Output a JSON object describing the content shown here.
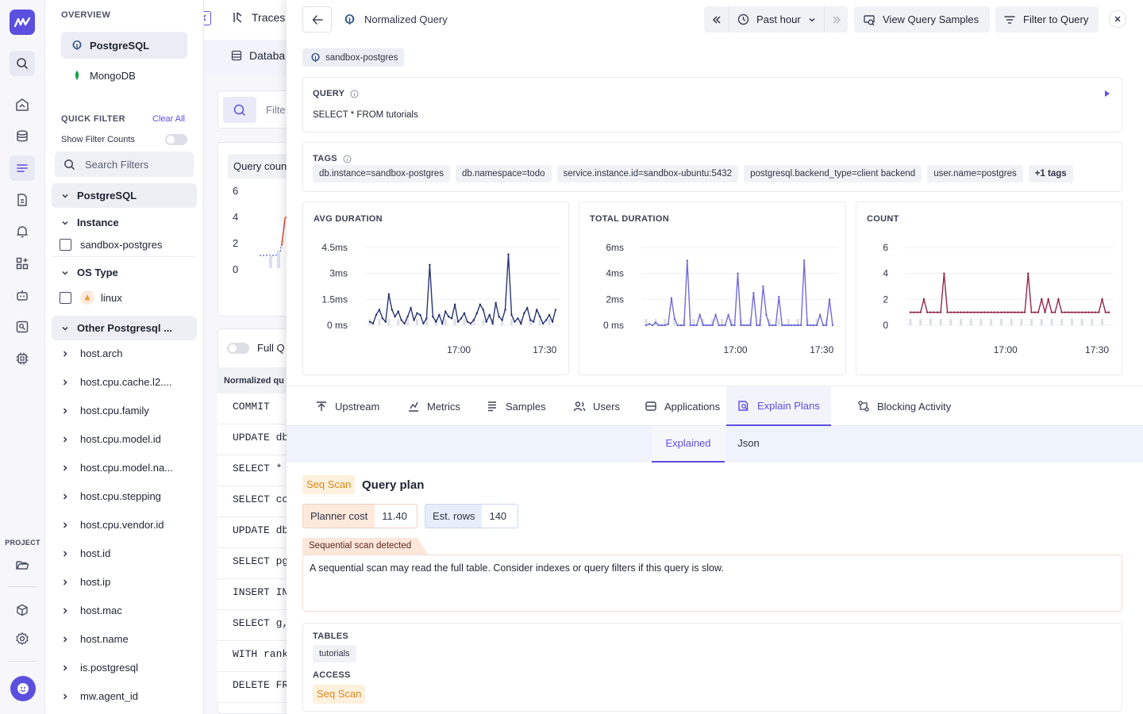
{
  "sidebar": {
    "project_label": "PROJECT",
    "icons": [
      "logo-icon",
      "search-icon",
      "dashboard-icon",
      "database-icon",
      "logs-icon",
      "document-icon",
      "alert-icon",
      "apps-icon",
      "robot-icon",
      "user-search-icon",
      "chip-icon",
      "folder-icon",
      "package-icon",
      "settings-icon",
      "avatar-icon"
    ]
  },
  "filter_panel": {
    "overview_title": "OVERVIEW",
    "databases": [
      {
        "label": "PostgreSQL",
        "selected": true
      },
      {
        "label": "MongoDB",
        "selected": false
      }
    ],
    "quick_filter_title": "QUICK FILTER",
    "clear_all": "Clear All",
    "show_filter_counts": "Show Filter Counts",
    "search_placeholder": "Search Filters",
    "groups": {
      "postgresql": "PostgreSQL",
      "instance": "Instance",
      "instance_value": "sandbox-postgres",
      "os_type": "OS Type",
      "os_value": "linux",
      "other": "Other Postgresql ..."
    },
    "attributes": [
      "host.arch",
      "host.cpu.cache.l2....",
      "host.cpu.family",
      "host.cpu.model.id",
      "host.cpu.model.na...",
      "host.cpu.stepping",
      "host.cpu.vendor.id",
      "host.id",
      "host.ip",
      "host.mac",
      "host.name",
      "is.postgresql",
      "mw.agent_id"
    ]
  },
  "background": {
    "traces_label": "Traces",
    "databases_tab": "Databa",
    "filter_placeholder": "Filte",
    "query_count_title": "Query coun",
    "query_count_ticks": [
      "6",
      "4",
      "2",
      "0"
    ],
    "full_query_label": "Full Q",
    "normalized_header": "Normalized qu",
    "rows": [
      "COMMIT",
      "UPDATE db",
      "SELECT *",
      "SELECT co",
      "UPDATE db",
      "SELECT pg",
      "INSERT IN",
      "SELECT g,",
      "WITH rank",
      "DELETE FR"
    ]
  },
  "drawer": {
    "title": "Normalized Query",
    "time_range": "Past hour",
    "view_samples": "View Query Samples",
    "filter_to_query": "Filter to Query",
    "instance_chip": "sandbox-postgres",
    "query_label": "QUERY",
    "query_text": "SELECT * FROM tutorials",
    "tags_label": "TAGS",
    "tags": [
      "db.instance=sandbox-postgres",
      "db.namespace=todo",
      "service.instance.id=sandbox-ubuntu:5432",
      "postgresql.backend_type=client backend",
      "user.name=postgres"
    ],
    "more_tags": "+1 tags",
    "tabs": [
      {
        "label": "Upstream",
        "icon": "upstream-icon"
      },
      {
        "label": "Metrics",
        "icon": "metrics-icon"
      },
      {
        "label": "Samples",
        "icon": "samples-icon"
      },
      {
        "label": "Users",
        "icon": "users-icon"
      },
      {
        "label": "Applications",
        "icon": "applications-icon"
      },
      {
        "label": "Explain Plans",
        "icon": "explain-plans-icon",
        "active": true
      },
      {
        "label": "Blocking Activity",
        "icon": "blocking-activity-icon"
      }
    ],
    "subtabs": [
      "Explained",
      "Json"
    ],
    "active_subtab": "Explained",
    "plan": {
      "node_badge": "Seq Scan",
      "title": "Query plan",
      "planner_cost_label": "Planner cost",
      "planner_cost_value": "11.40",
      "est_rows_label": "Est. rows",
      "est_rows_value": "140",
      "warning_title": "Sequential scan detected",
      "warning_text": "A sequential scan may read the full table. Consider indexes or query filters if this query is slow.",
      "tables_label": "TABLES",
      "table_name": "tutorials",
      "access_label": "ACCESS",
      "access_value": "Seq Scan"
    }
  },
  "colors": {
    "accent": "#5b4fe0",
    "avg_series": "#1c2a6b",
    "total_series": "#6a63d6",
    "count_series": "#8d1b43",
    "warning_bg": "#fde6da",
    "badge_bg": "#fdf0dd"
  },
  "chart_data": [
    {
      "type": "line",
      "title": "AVG DURATION",
      "ylabel": "",
      "ytick_labels": [
        "4.5ms",
        "3ms",
        "1.5ms",
        "0 ms"
      ],
      "xtick_labels": [
        "17:00",
        "17:30"
      ],
      "ylim": [
        0,
        4.5
      ],
      "units": "ms",
      "x": [
        0,
        1,
        2,
        3,
        4,
        5,
        6,
        7,
        8,
        9,
        10,
        11,
        12,
        13,
        14,
        15,
        16,
        17,
        18,
        19,
        20,
        21,
        22,
        23,
        24,
        25,
        26,
        27,
        28,
        29,
        30,
        31,
        32,
        33,
        34,
        35,
        36,
        37,
        38,
        39,
        40,
        41,
        42,
        43,
        44,
        45,
        46,
        47,
        48,
        49,
        50,
        51,
        52,
        53,
        54,
        55,
        56,
        57,
        58,
        59
      ],
      "series": [
        {
          "values": [
            0.2,
            0.1,
            0.6,
            0.9,
            0.4,
            0.2,
            1.8,
            0.9,
            0.5,
            0.8,
            0.3,
            0.1,
            0.5,
            1.0,
            0.3,
            0.7,
            0.6,
            0.1,
            0.4,
            3.5,
            0.5,
            0.2,
            0.6,
            0.1,
            0.8,
            0.5,
            0.4,
            1.2,
            0.2,
            0.4,
            0.7,
            0.2,
            0.1,
            0.3,
            0.7,
            1.2,
            0.9,
            0.2,
            0.6,
            0.1,
            1.3,
            0.5,
            0.3,
            0.9,
            4.1,
            0.6,
            0.2,
            0.4,
            0.1,
            0.7,
            1.0,
            0.3,
            0.2,
            0.9,
            0.5,
            0.1,
            0.3,
            0.6,
            0.2,
            0.9
          ]
        }
      ]
    },
    {
      "type": "line",
      "title": "TOTAL DURATION",
      "ylabel": "",
      "ytick_labels": [
        "6ms",
        "4ms",
        "2ms",
        "0 ms"
      ],
      "xtick_labels": [
        "17:00",
        "17:30"
      ],
      "ylim": [
        0,
        6
      ],
      "units": "ms",
      "x": [
        0,
        1,
        2,
        3,
        4,
        5,
        6,
        7,
        8,
        9,
        10,
        11,
        12,
        13,
        14,
        15,
        16,
        17,
        18,
        19,
        20,
        21,
        22,
        23,
        24,
        25,
        26,
        27,
        28,
        29,
        30,
        31,
        32,
        33,
        34,
        35,
        36,
        37,
        38,
        39,
        40,
        41,
        42,
        43,
        44,
        45,
        46,
        47,
        48,
        49,
        50,
        51,
        52,
        53,
        54,
        55,
        56,
        57,
        58,
        59
      ],
      "series": [
        {
          "values": [
            0,
            0.1,
            0,
            0.2,
            0,
            0,
            0,
            0.1,
            2.1,
            0.5,
            0,
            0,
            0,
            5.0,
            0,
            0,
            0,
            0.8,
            0,
            0,
            0,
            0,
            0.8,
            0,
            0,
            0,
            0.8,
            0,
            0,
            4.0,
            0,
            0,
            0,
            0,
            2.5,
            0,
            0,
            3.0,
            0.8,
            0,
            0,
            0,
            2.2,
            0,
            0,
            0,
            0,
            0,
            0,
            0,
            5.0,
            0,
            0,
            0,
            0,
            0.8,
            0,
            0,
            2.0,
            0
          ]
        }
      ]
    },
    {
      "type": "line",
      "title": "COUNT",
      "ylabel": "",
      "ytick_labels": [
        "6",
        "4",
        "2",
        "0"
      ],
      "xtick_labels": [
        "17:00",
        "17:30"
      ],
      "ylim": [
        0,
        6
      ],
      "x": [
        0,
        1,
        2,
        3,
        4,
        5,
        6,
        7,
        8,
        9,
        10,
        11,
        12,
        13,
        14,
        15,
        16,
        17,
        18,
        19,
        20,
        21,
        22,
        23,
        24,
        25,
        26,
        27,
        28,
        29,
        30,
        31,
        32,
        33,
        34,
        35,
        36,
        37,
        38,
        39,
        40,
        41,
        42,
        43,
        44,
        45,
        46,
        47,
        48,
        49,
        50,
        51,
        52,
        53,
        54,
        55,
        56,
        57,
        58,
        59
      ],
      "series": [
        {
          "values": [
            1,
            1,
            1,
            1,
            2,
            1,
            1,
            1,
            1,
            1,
            4,
            1,
            1,
            1,
            1,
            1,
            1,
            1,
            1,
            1,
            1,
            1,
            1,
            1,
            1,
            1,
            1,
            1,
            1,
            1,
            1,
            1,
            1,
            1,
            1,
            4,
            1,
            1,
            1,
            2,
            1,
            2,
            1,
            1,
            2,
            1,
            1,
            1,
            1,
            1,
            1,
            1,
            1,
            1,
            1,
            1,
            1,
            2,
            1,
            1
          ]
        }
      ]
    }
  ]
}
